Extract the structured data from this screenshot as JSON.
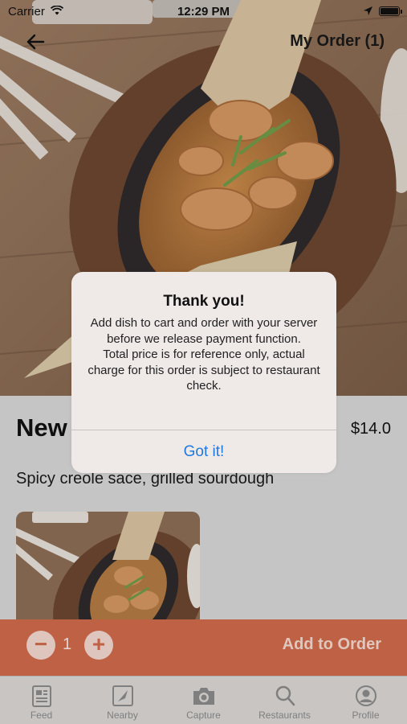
{
  "status_bar": {
    "carrier": "Carrier",
    "time": "12:29 PM"
  },
  "header": {
    "back_icon": "arrow-left-icon",
    "my_order": "My Order (1)"
  },
  "dish": {
    "name": "New",
    "price": "$14.0",
    "description": "Spicy creole sace, grilled sourdough"
  },
  "order_bar": {
    "minus": "−",
    "quantity": "1",
    "plus": "+",
    "add_label": "Add to Order",
    "color": "#d06a4b"
  },
  "tabs": [
    {
      "label": "Feed",
      "icon": "newspaper-icon"
    },
    {
      "label": "Nearby",
      "icon": "map-pin-icon"
    },
    {
      "label": "Capture",
      "icon": "camera-icon"
    },
    {
      "label": "Restaurants",
      "icon": "search-icon"
    },
    {
      "label": "Profile",
      "icon": "person-icon"
    }
  ],
  "alert": {
    "title": "Thank you!",
    "line1": "Add dish to cart and order with your server before we release payment function.",
    "line2": "Total price is for reference only, actual charge for this order is subject to restaurant check.",
    "button": "Got it!",
    "button_color": "#1f7ae0"
  }
}
